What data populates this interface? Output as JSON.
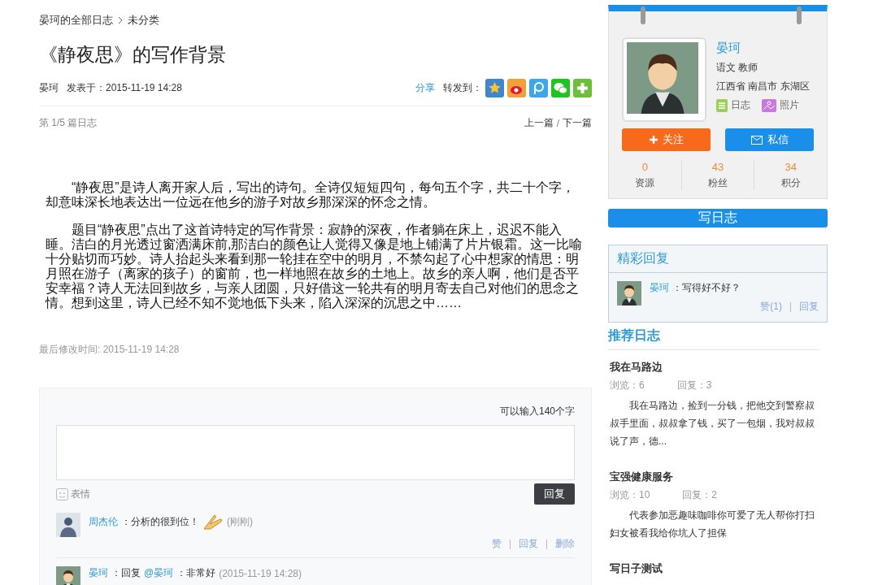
{
  "breadcrumb": {
    "items": [
      "晏珂的全部日志",
      "未分类"
    ]
  },
  "article": {
    "title": "《静夜思》的写作背景",
    "author": "晏珂",
    "posted": "发表于：2015-11-19 14:28",
    "share_label": "分享",
    "forward_label": "转发到：",
    "position": "第 1/5 篇日志",
    "prev": "上一篇",
    "nav_separator": "/",
    "next": "下一篇",
    "paragraphs": [
      "“静夜思”是诗人离开家人后，写出的诗句。全诗仅短短四句，每句五个字，共二十个字，却意味深长地表达出一位远在他乡的游子对故乡那深深的怀念之情。",
      "题目“静夜思”点出了这首诗特定的写作背景：寂静的深夜，作者躺在床上，迟迟不能入睡。洁白的月光透过窗洒满床前,那洁白的颜色让人觉得又像是地上铺满了片片银霜。这一比喻十分贴切而巧妙。诗人抬起头来看到那一轮挂在空中的明月，不禁勾起了心中想家的情思：明月照在游子（离家的孩子）的窗前，也一样地照在故乡的土地上。故乡的亲人啊，他们是否平安幸福？诗人无法回到故乡，与亲人团圆，只好借这一轮共有的明月寄去自己对他们的思念之情。想到这里，诗人已经不知不觉地低下头来，陷入深深的沉思之中……"
    ],
    "modified": "最后修改时间: 2015-11-19 14:28"
  },
  "comment_box": {
    "counter": "可以输入140个字",
    "emoji_label": "表情",
    "submit": "回复"
  },
  "comments": [
    {
      "author": "周杰伦",
      "text": "：分析的很到位！",
      "time": "(刚刚)",
      "emoji": true,
      "actions": [
        "赞",
        "回复",
        "删除"
      ]
    },
    {
      "author": "晏珂",
      "text": "：回复",
      "mention": "@晏珂",
      "text_after": "：非常好",
      "time": "(2015-11-19 14:28)",
      "emoji": false
    }
  ],
  "profile": {
    "name": "晏珂",
    "subject": "语文 教师",
    "location": "江西省 南昌市 东湖区",
    "links": [
      {
        "kind": "journal",
        "label": "日志"
      },
      {
        "kind": "photo",
        "label": "照片"
      }
    ],
    "follow": "关注",
    "message": "私信",
    "stats": [
      {
        "value": "0",
        "label": "资源"
      },
      {
        "value": "43",
        "label": "粉丝"
      },
      {
        "value": "34",
        "label": "积分"
      }
    ]
  },
  "write_button": "写日志",
  "featured_replies": {
    "title": "精彩回复",
    "items": [
      {
        "author": "晏珂",
        "text": "：写得好不好？",
        "like": "赞(1)",
        "reply": "回复"
      }
    ]
  },
  "recommended": {
    "title": "推荐日志",
    "items": [
      {
        "title": "我在马路边",
        "views": "浏览：6",
        "replies": "回复：3",
        "excerpt": "我在马路边，捡到一分钱，把他交到警察叔叔手里面，叔叔拿了钱，买了一包烟，我对叔叔说了声，德..."
      },
      {
        "title": "宝强健康服务",
        "views": "浏览：10",
        "replies": "回复：2",
        "excerpt": "代表参加恶趣味咖啡你可爱了无人帮你打扫妇女被看我给你坑人了担保"
      },
      {
        "title": "写日子测试"
      }
    ]
  }
}
